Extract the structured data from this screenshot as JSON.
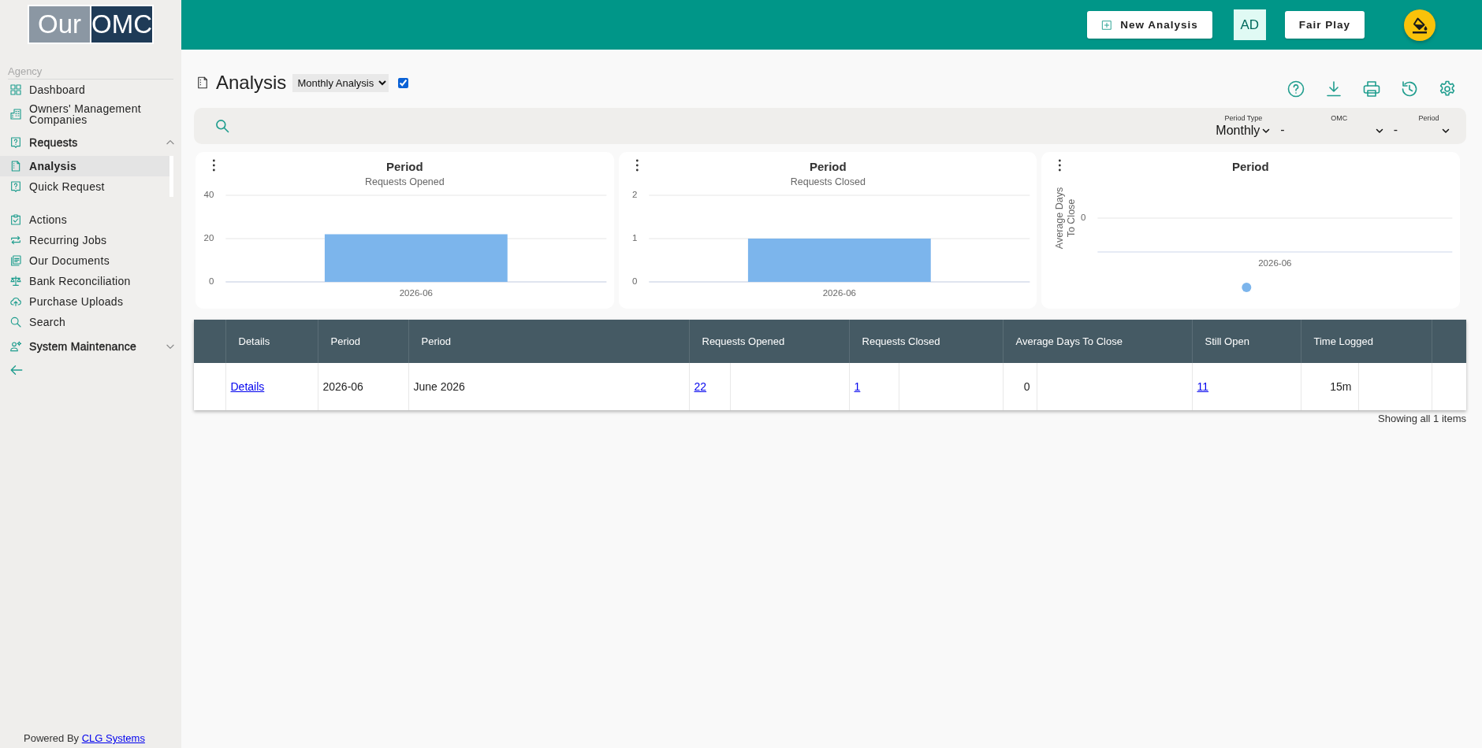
{
  "sidebar": {
    "logo": {
      "left": "Our",
      "right": "OMC"
    },
    "section": "Agency",
    "items": [
      {
        "label": "Dashboard",
        "selected": false
      },
      {
        "label": "Owners' Management Companies",
        "selected": false
      },
      {
        "label": "Requests",
        "selected": false,
        "expanded": true,
        "children": [
          {
            "label": "Analysis",
            "selected": true
          },
          {
            "label": "Quick Request",
            "selected": false
          }
        ]
      },
      {
        "label": "Actions",
        "selected": false
      },
      {
        "label": "Recurring Jobs",
        "selected": false
      },
      {
        "label": "Our Documents",
        "selected": false
      },
      {
        "label": "Bank Reconciliation",
        "selected": false
      },
      {
        "label": "Purchase Uploads",
        "selected": false
      },
      {
        "label": "Search",
        "selected": false
      },
      {
        "label": "System Maintenance",
        "selected": false,
        "expanded": false
      }
    ],
    "footer": {
      "text": "Powered By",
      "link": "CLG Systems"
    }
  },
  "topbar": {
    "buttons": [
      {
        "kind": "action",
        "label": "New Analysis"
      },
      {
        "kind": "avatar",
        "label": "AD"
      },
      {
        "kind": "plain",
        "label": "Fair Play"
      }
    ]
  },
  "page": {
    "title": "Analysis",
    "view_select": "Monthly Analysis",
    "option_checkbox": {
      "checked": true
    }
  },
  "filter_bar": {
    "fields": [
      {
        "kind": "select",
        "label": "Period Type",
        "value": "Monthly"
      },
      {
        "kind": "separator",
        "text": "-"
      },
      {
        "kind": "select",
        "label": "OMC"
      },
      {
        "kind": "separator",
        "text": "-"
      },
      {
        "kind": "select",
        "label": "Period"
      }
    ]
  },
  "charts": [
    {
      "subtitle": "Requests Opened",
      "chart_data": {
        "type": "bar",
        "title": "Period",
        "categories": [
          "2026-06"
        ],
        "values": [
          22
        ],
        "ylim": [
          0,
          40
        ],
        "yticks": [
          0,
          20,
          40
        ]
      }
    },
    {
      "subtitle": "Requests Closed",
      "chart_data": {
        "type": "bar",
        "title": "Period",
        "categories": [
          "2026-06"
        ],
        "values": [
          1
        ],
        "ylim": [
          0,
          2
        ],
        "yticks": [
          0,
          1,
          2
        ]
      }
    },
    {
      "title": "Period",
      "y_axis_title": "Average Days To Close",
      "y_tick_label": "0",
      "x_label": "2026-06",
      "legend": true
    }
  ],
  "table": {
    "columns": [
      "Details",
      "Period",
      "Period",
      "Requests Opened",
      "Requests Closed",
      "Average Days To Close",
      "Still Open",
      "Time Logged"
    ],
    "rows": [
      {
        "cells": [
          {
            "kind": "link",
            "text": "Details"
          },
          {
            "kind": "text",
            "text": "2026-06"
          },
          {
            "kind": "text",
            "text": "June 2026"
          },
          {
            "kind": "link",
            "text": "22"
          },
          {
            "kind": "link",
            "text": "1"
          },
          {
            "kind": "number",
            "text": "0"
          },
          {
            "kind": "link",
            "text": "11"
          },
          {
            "kind": "number",
            "text": "15m"
          }
        ]
      }
    ],
    "status": "Showing all 1 items"
  }
}
